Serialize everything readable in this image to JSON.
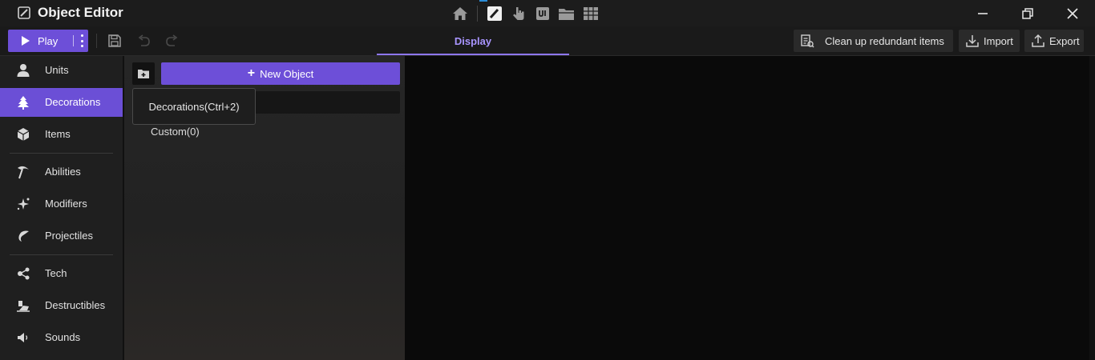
{
  "app": {
    "title": "Object Editor"
  },
  "mode_icons": [
    "home-icon",
    "brush-icon",
    "pointer-hand-icon",
    "ui-icon",
    "folder-icon",
    "table-icon"
  ],
  "toolbar": {
    "play_label": "Play",
    "tab_label": "Display",
    "clean_label": "Clean up redundant items",
    "import_label": "Import",
    "export_label": "Export"
  },
  "sidebar": {
    "items": [
      {
        "label": "Units",
        "icon": "user-icon",
        "active": false
      },
      {
        "label": "Decorations",
        "icon": "tree-icon",
        "active": true
      },
      {
        "label": "Items",
        "icon": "cube-icon",
        "active": false
      },
      {
        "label": "Abilities",
        "icon": "pickaxe-icon",
        "active": false
      },
      {
        "label": "Modifiers",
        "icon": "sparkle-icon",
        "active": false
      },
      {
        "label": "Projectiles",
        "icon": "swirl-icon",
        "active": false
      },
      {
        "label": "Tech",
        "icon": "nodes-icon",
        "active": false
      },
      {
        "label": "Destructibles",
        "icon": "rubble-icon",
        "active": false
      },
      {
        "label": "Sounds",
        "icon": "speaker-icon",
        "active": false
      }
    ]
  },
  "panel": {
    "new_object_label": "New Object",
    "tooltip": "Decorations(Ctrl+2)",
    "custom_label": "Custom(0)"
  },
  "colors": {
    "accent": "#6d4fd8",
    "tab_text": "#a995ff"
  }
}
